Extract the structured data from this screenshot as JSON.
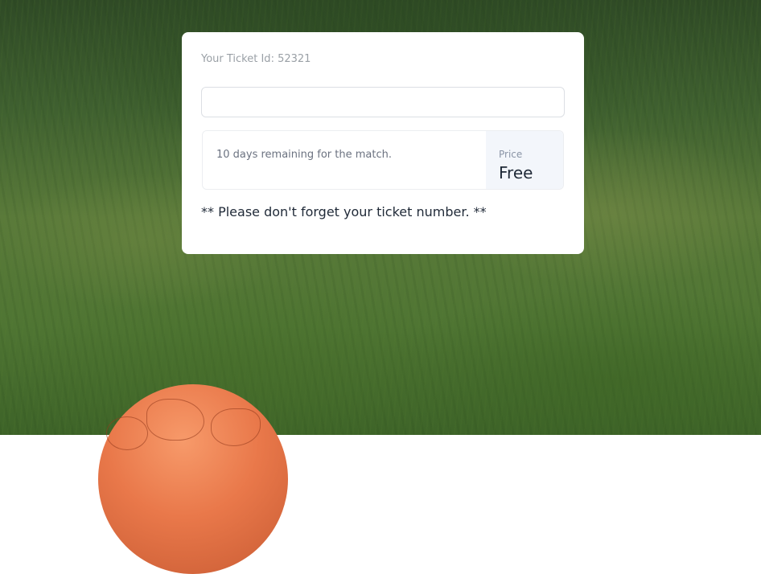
{
  "ticket": {
    "id_text": "Your Ticket Id: 52321",
    "input_value": "",
    "remaining_text": "10 days remaining for the match.",
    "price_label": "Price",
    "price_value": "Free",
    "reminder_text": "** Please don't forget your ticket number. **"
  },
  "colors": {
    "card_background": "#ffffff",
    "price_panel_background": "#f3f6fb",
    "ball": "#e9784a"
  },
  "icons": {
    "background_image": "grass-field-with-orange-ball"
  }
}
